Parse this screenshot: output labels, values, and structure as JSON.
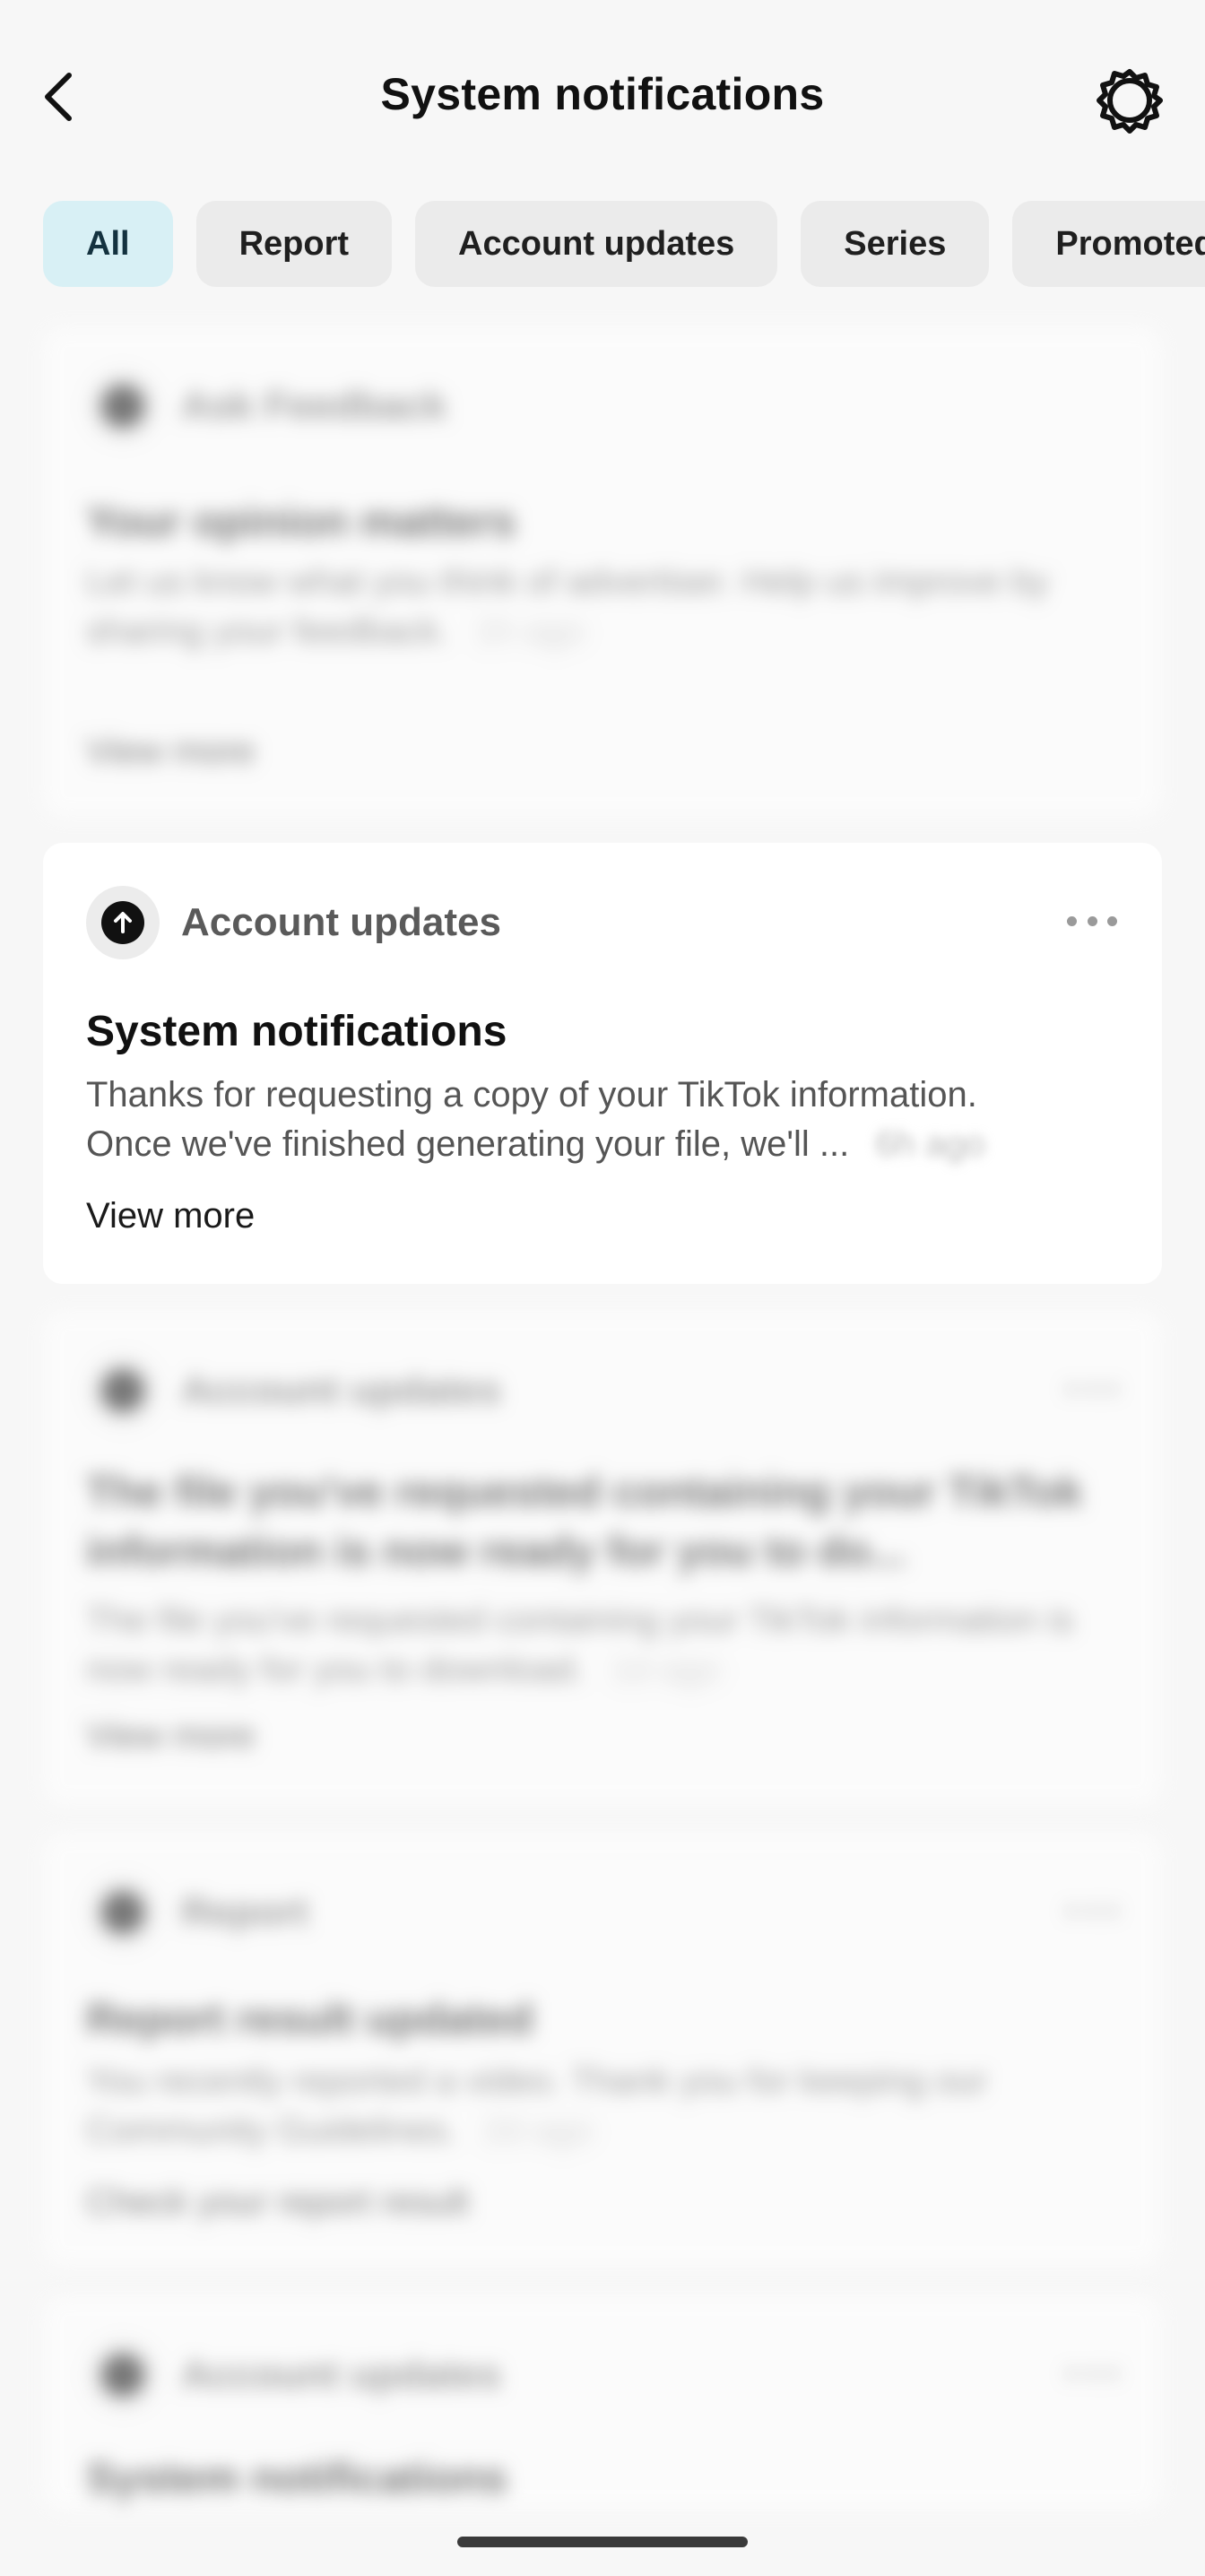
{
  "header": {
    "title": "System notifications"
  },
  "filters": [
    {
      "label": "All",
      "active": true
    },
    {
      "label": "Report",
      "active": false
    },
    {
      "label": "Account updates",
      "active": false
    },
    {
      "label": "Series",
      "active": false
    },
    {
      "label": "Promoted",
      "active": false
    }
  ],
  "cards": [
    {
      "category": "Ask Feedback",
      "title": "Your opinion matters",
      "body": "Let us know what you think of advertiser. Help us improve by sharing your feedback.",
      "time": "1h ago",
      "action": "View more"
    },
    {
      "category": "Account updates",
      "title": "System notifications",
      "body_line1": "Thanks for requesting a copy of your TikTok information.",
      "body_line2": "Once we've finished generating your file, we'll ...",
      "time": "6h ago",
      "action": "View more"
    },
    {
      "category": "Account updates",
      "title": "The file you've requested containing your TikTok information is now ready for you to do...",
      "body": "The file you've requested containing your TikTok information is now ready for you to download.",
      "time": "1d ago",
      "action": "View more"
    },
    {
      "category": "Report",
      "title": "Report result updated",
      "body": "You recently reported a video. Thank you for keeping our Community Guidelines.",
      "time": "2d ago",
      "action": "Check your report result"
    },
    {
      "category": "Account updates",
      "title": "System notifications"
    }
  ]
}
